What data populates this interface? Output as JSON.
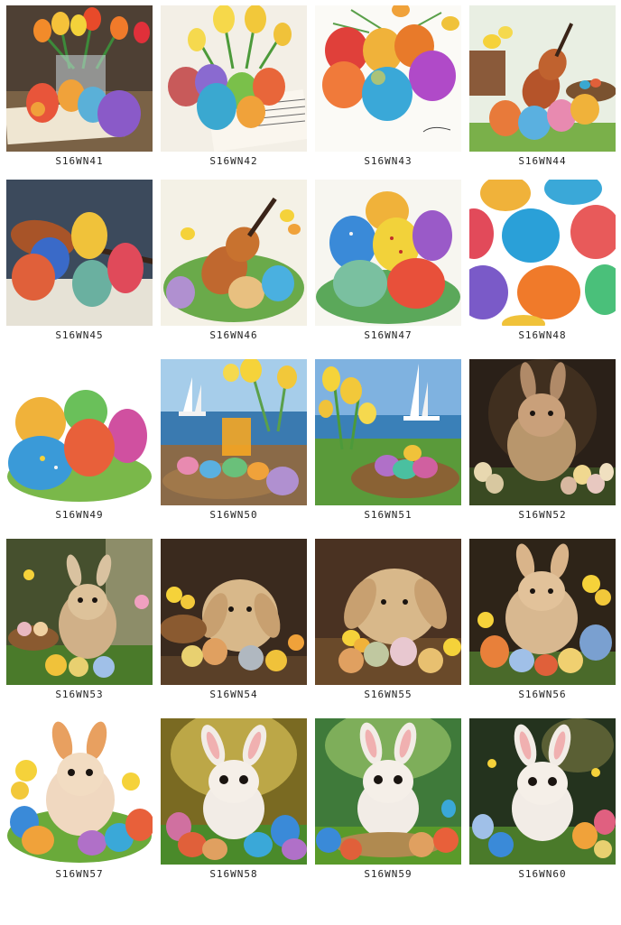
{
  "tiles": [
    {
      "label": "S16WN41",
      "scene": "tulips-eggs-book",
      "bg": "#5a4a3c",
      "accent": "#e8663a"
    },
    {
      "label": "S16WN42",
      "scene": "tulips-eggs-sheet-music",
      "bg": "#f2ece2",
      "accent": "#f5d33a"
    },
    {
      "label": "S16WN43",
      "scene": "eggs-flowers",
      "bg": "#fbfaf6",
      "accent": "#e8b43a"
    },
    {
      "label": "S16WN44",
      "scene": "violin-eggs-basket",
      "bg": "#e9efe3",
      "accent": "#b5542a"
    },
    {
      "label": "S16WN45",
      "scene": "violin-eggs",
      "bg": "#3a4658",
      "accent": "#b5542a"
    },
    {
      "label": "S16WN46",
      "scene": "violin-eggs-grass",
      "bg": "#f4f1e6",
      "accent": "#c0682f"
    },
    {
      "label": "S16WN47",
      "scene": "eggs-grass",
      "bg": "#f7f6f0",
      "accent": "#5ba85a"
    },
    {
      "label": "S16WN48",
      "scene": "egg-pattern",
      "bg": "#ffffff",
      "accent": "#e24a5a"
    },
    {
      "label": "S16WN49",
      "scene": "eggs-grass-watercolor",
      "bg": "#ffffff",
      "accent": "#5ba85a"
    },
    {
      "label": "S16WN50",
      "scene": "sailboat-juice-basket",
      "bg": "#9cc3e6",
      "accent": "#f5a623"
    },
    {
      "label": "S16WN51",
      "scene": "sailboat-tulips-nest",
      "bg": "#7fb2e0",
      "accent": "#f5d33a"
    },
    {
      "label": "S16WN52",
      "scene": "bunny-eggs-dark",
      "bg": "#2a2018",
      "accent": "#c9a07a"
    },
    {
      "label": "S16WN53",
      "scene": "bunny-basket-forest",
      "bg": "#46502e",
      "accent": "#d9c2a0"
    },
    {
      "label": "S16WN54",
      "scene": "lop-bunny-flowers",
      "bg": "#3a2a1e",
      "accent": "#e0c39a"
    },
    {
      "label": "S16WN55",
      "scene": "lop-bunny-nest",
      "bg": "#4a3222",
      "accent": "#e0c39a"
    },
    {
      "label": "S16WN56",
      "scene": "bunny-daffodils",
      "bg": "#2e2418",
      "accent": "#d9b48a"
    },
    {
      "label": "S16WN57",
      "scene": "bunny-flowers-white",
      "bg": "#ffffff",
      "accent": "#e8a060"
    },
    {
      "label": "S16WN58",
      "scene": "cartoon-bunny-meadow",
      "bg": "#9a8a2a",
      "accent": "#f2ece6"
    },
    {
      "label": "S16WN59",
      "scene": "cartoon-bunny-nest",
      "bg": "#3f7a3a",
      "accent": "#f2ece6"
    },
    {
      "label": "S16WN60",
      "scene": "cartoon-bunny-dark",
      "bg": "#24331e",
      "accent": "#f2ece6"
    }
  ]
}
